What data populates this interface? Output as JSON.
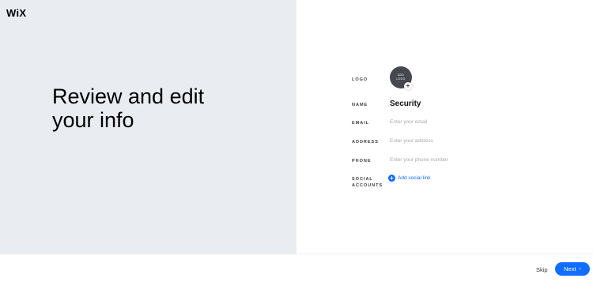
{
  "brand": {
    "logo_text": "WiX"
  },
  "headline": {
    "line1": "Review and edit",
    "line2": "your info"
  },
  "form": {
    "logo": {
      "label": "LOGO",
      "avatar_text_line1": "ADD",
      "avatar_text_line2": "LOGO",
      "add_symbol": "+"
    },
    "name": {
      "label": "NAME",
      "value": "Security"
    },
    "email": {
      "label": "EMAIL",
      "placeholder": "Enter your email"
    },
    "address": {
      "label": "ADDRESS",
      "placeholder": "Enter your address"
    },
    "phone": {
      "label": "PHONE",
      "placeholder": "Enter your phone number"
    },
    "social": {
      "label_line1": "SOCIAL",
      "label_line2": "ACCOUNTS",
      "add_symbol": "+",
      "add_label": "Add social link"
    }
  },
  "footer": {
    "skip_label": "Skip",
    "next_label": "Next",
    "next_icon": "›"
  },
  "colors": {
    "accent": "#116dff",
    "left_panel_bg": "#e9edf2",
    "avatar_bg": "#45494f"
  }
}
